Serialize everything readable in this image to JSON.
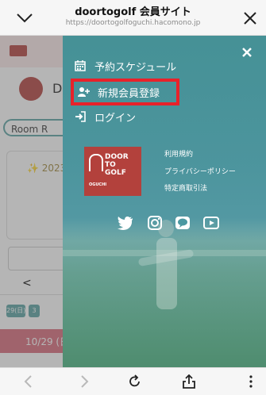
{
  "browser": {
    "title": "doortogolf 会員サイト",
    "url": "https://doortogolfoguchi.hacomono.jp"
  },
  "background_page": {
    "avatar_letter": "D",
    "room_pill": "Room R",
    "year_label": "✨ 2023",
    "nav_arrow": "<",
    "day_chips": [
      "29(日)",
      "3"
    ],
    "date_bar": "10/29 (日"
  },
  "drawer": {
    "menu": [
      {
        "label": "予約スケジュール",
        "icon": "calendar-icon"
      },
      {
        "label": "新規会員登録",
        "icon": "add-user-icon",
        "highlighted": true
      },
      {
        "label": "ログイン",
        "icon": "login-icon"
      }
    ],
    "brand": {
      "line1": "DOOR",
      "line2": "TO",
      "line3": "GOLF",
      "location": "OGUCHI"
    },
    "links": [
      "利用規約",
      "プライバシーポリシー",
      "特定商取引法"
    ],
    "social": [
      "twitter-icon",
      "instagram-icon",
      "line-icon",
      "youtube-icon"
    ]
  },
  "colors": {
    "highlight": "#e8222a",
    "brand_red": "#b3413c",
    "drawer_teal": "#4b98a1",
    "accent_pink": "#d96b7b"
  }
}
